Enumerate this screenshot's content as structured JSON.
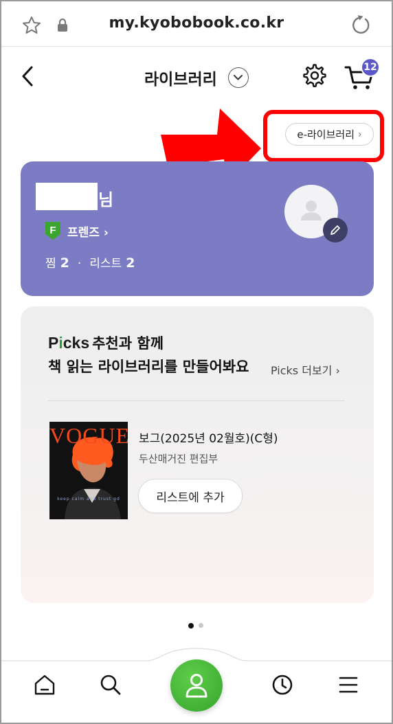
{
  "browser": {
    "url": "my.kyobobook.co.kr"
  },
  "header": {
    "title": "라이브러리",
    "cart_count": "12"
  },
  "e_library_button": {
    "label": "e-라이브러리",
    "chevron": "›"
  },
  "profile": {
    "name_suffix": "님",
    "grade_letter": "F",
    "grade_label": "프렌즈 ›",
    "stats": {
      "wish_label": "찜",
      "wish_count": "2",
      "separator": "·",
      "list_label": "리스트",
      "list_count": "2"
    }
  },
  "picks": {
    "logo": "Picks",
    "headline_rest": "추천과 함께",
    "headline_line2": "책 읽는 라이브러리를 만들어봐요",
    "more_label": "Picks 더보기 ›",
    "book": {
      "cover_title": "VOGUE",
      "cover_tagline": "keep calm and trust gd",
      "title": "보그(2025년 02월호)(C형)",
      "author": "두산매거진 편집부",
      "add_button": "리스트에 추가"
    }
  },
  "colors": {
    "profile_card": "#7b7cc3",
    "badge": "#5b59c7",
    "accent_green": "#3aa62f",
    "highlight_red": "#ff0000"
  },
  "icons": {
    "bottom_nav": [
      "home-icon",
      "search-icon",
      "my-library-icon",
      "recent-icon",
      "menu-icon"
    ]
  }
}
